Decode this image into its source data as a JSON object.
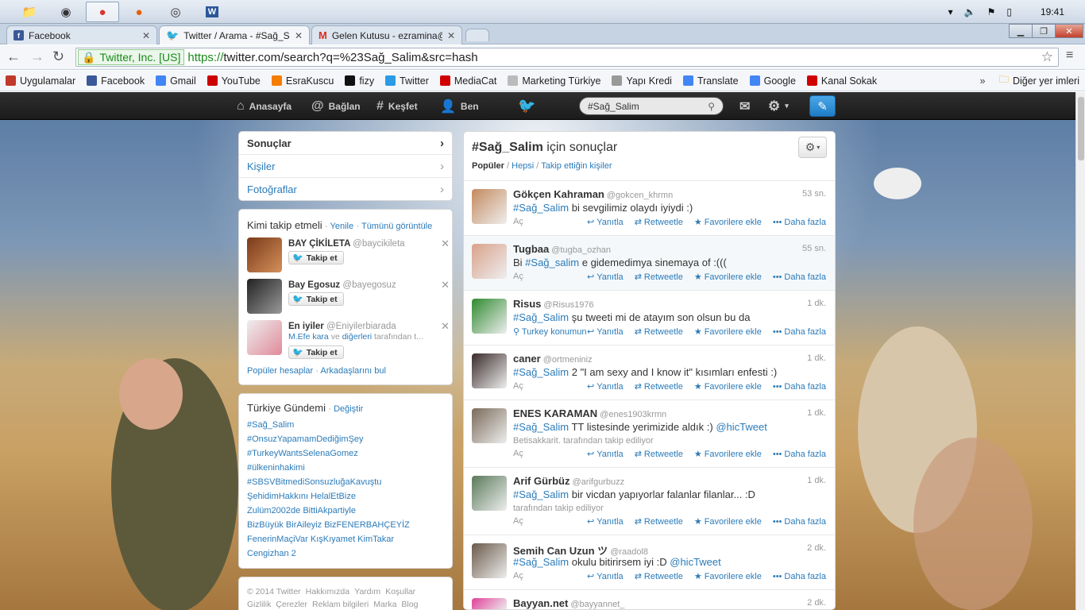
{
  "taskbar": {
    "clock": "19:41",
    "tray_icons": [
      "triangle-up-icon",
      "speaker-icon",
      "flag-icon",
      "battery-icon"
    ]
  },
  "browser": {
    "tabs": [
      {
        "title": "Facebook"
      },
      {
        "title": "Twitter / Arama - #Sağ_Sa"
      },
      {
        "title": "Gelen Kutusu - ezramina@"
      }
    ],
    "ev_label": "Twitter, Inc. [US]",
    "url_scheme": "https://",
    "url_rest": "twitter.com/search?q=%23Sağ_Salim&src=hash",
    "bookmarks": [
      {
        "label": "Uygulamalar",
        "color": "#c0392b"
      },
      {
        "label": "Facebook",
        "color": "#3b5998"
      },
      {
        "label": "Gmail",
        "color": "#4285f4"
      },
      {
        "label": "YouTube",
        "color": "#cc0000"
      },
      {
        "label": "EsraKuscu",
        "color": "#f57d00"
      },
      {
        "label": "fizy",
        "color": "#111111"
      },
      {
        "label": "Twitter",
        "color": "#2b9be6"
      },
      {
        "label": "MediaCat",
        "color": "#d10000"
      },
      {
        "label": "Marketing Türkiye",
        "color": "#bbbbbb"
      },
      {
        "label": "Yapı Kredi",
        "color": "#999999"
      },
      {
        "label": "Translate",
        "color": "#4285f4"
      },
      {
        "label": "Google",
        "color": "#4285f4"
      },
      {
        "label": "Kanal Sokak",
        "color": "#d10000"
      }
    ],
    "other_bookmarks": "Diğer yer imleri"
  },
  "twitter": {
    "nav": {
      "home": "Anasayfa",
      "connect": "Bağlan",
      "discover": "Keşfet",
      "me": "Ben"
    },
    "search_value": "#Sağ_Salim",
    "sidebar": {
      "items": [
        "Sonuçlar",
        "Kişiler",
        "Fotoğraflar"
      ]
    },
    "who_to_follow": {
      "title": "Kimi takip etmeli",
      "refresh": "Yenile",
      "view_all": "Tümünü görüntüle",
      "follow_label": "Takip et",
      "users": [
        {
          "name": "BAY ÇİKİLETA",
          "handle": "@baycikileta"
        },
        {
          "name": "Bay Egosuz",
          "handle": "@bayegosuz"
        },
        {
          "name": "En iyiler",
          "handle": "@Eniyilerbiarada",
          "followed_by_name": "M.Efe kara",
          "followed_by_mid": "ve",
          "followed_by_others": "diğerleri",
          "followed_by_suffix": "tarafından t..."
        }
      ],
      "popular": "Popüler hesaplar",
      "find_friends": "Arkadaşlarını bul"
    },
    "trends": {
      "title": "Türkiye Gündemi",
      "change": "Değiştir",
      "items": [
        "#Sağ_Salim",
        "#OnsuzYapamamDediğimŞey",
        "#TurkeyWantsSelenaGomez",
        "#ülkeninhakimi",
        "#SBSVBitmediSonsuzluğaKavuştu",
        "ŞehidimHakkını HelalEtBize",
        "Zulüm2002de BittiAkpartiyle",
        "BizBüyük BirAileyiz BizFENERBAHÇEYİZ",
        "FenerinMaçiVar KışKıyamet KimTakar",
        "Cengizhan 2"
      ]
    },
    "footer": {
      "line1": [
        "© 2014 Twitter",
        "Hakkımızda",
        "Yardım",
        "Koşullar"
      ],
      "line2": [
        "Gizlilik",
        "Çerezler",
        "Reklam bilgileri",
        "Marka",
        "Blog"
      ]
    },
    "results": {
      "title_hashtag": "#Sağ_Salim",
      "title_suffix": "için sonuçlar",
      "filter_popular": "Popüler",
      "filter_all": "Hepsi",
      "filter_following": "Takip ettiğin kişiler",
      "actions": {
        "expand": "Aç",
        "reply": "Yanıtla",
        "retweet": "Retweetle",
        "favorite": "Favorilere ekle",
        "more": "Daha fazla"
      },
      "tweets": [
        {
          "name": "Gökçen Kahraman",
          "handle": "@gokcen_khrmn",
          "time": "53 sn.",
          "tag": "#Sağ_Salim",
          "text": " bi sevgilimiz olaydı iyiydi :)",
          "avatar": "#c48a5e"
        },
        {
          "name": "Tugbaa",
          "handle": "@tugba_ozhan",
          "time": "55 sn.",
          "prefix": "Bi ",
          "tag": "#Sağ_salim",
          "text": " e gidemedimya sinemaya of :(((",
          "avatar": "#d9a18a"
        },
        {
          "name": "Risus",
          "handle": "@Risus1976",
          "time": "1 dk.",
          "tag": "#Sağ_Salim",
          "text": " şu tweeti mi de atayım son olsun bu da",
          "avatar": "#2f8a2f",
          "location": "Turkey konumun"
        },
        {
          "name": "caner",
          "handle": "@ortmeniniz",
          "time": "1 dk.",
          "tag": "#Sağ_Salim",
          "text": " 2 \"I am sexy and I know it\" kısımları enfesti :)",
          "avatar": "#3a2a2a"
        },
        {
          "name": "ENES KARAMAN",
          "handle": "@enes1903krmn",
          "time": "1 dk.",
          "tag": "#Sağ_Salim",
          "text": " TT listesinde yerimizide aldık :) ",
          "mention": "@hicTweet",
          "note_link": "Betisakkarit.",
          "note": " tarafından takip ediliyor",
          "avatar": "#7a6a5a"
        },
        {
          "name": "Arif Gürbüz",
          "handle": "@arifgurbuzz",
          "time": "1 dk.",
          "tag": "#Sağ_Salim",
          "text": " bir vicdan yapıyorlar falanlar filanlar... :D",
          "note": "tarafından takip ediliyor",
          "avatar": "#5a7a5a"
        },
        {
          "name": "Semih Can Uzun ツ",
          "handle": "@raadol8",
          "time": "2 dk.",
          "tag": "#Sağ_Salim",
          "text": " okulu bitirirsem iyi :D ",
          "mention": "@hicTweet",
          "avatar": "#6a5a4a"
        },
        {
          "name": "Bayyan.net",
          "handle": "@bayyannet_",
          "time": "2 dk.",
          "avatar": "#e0409a"
        }
      ]
    }
  }
}
